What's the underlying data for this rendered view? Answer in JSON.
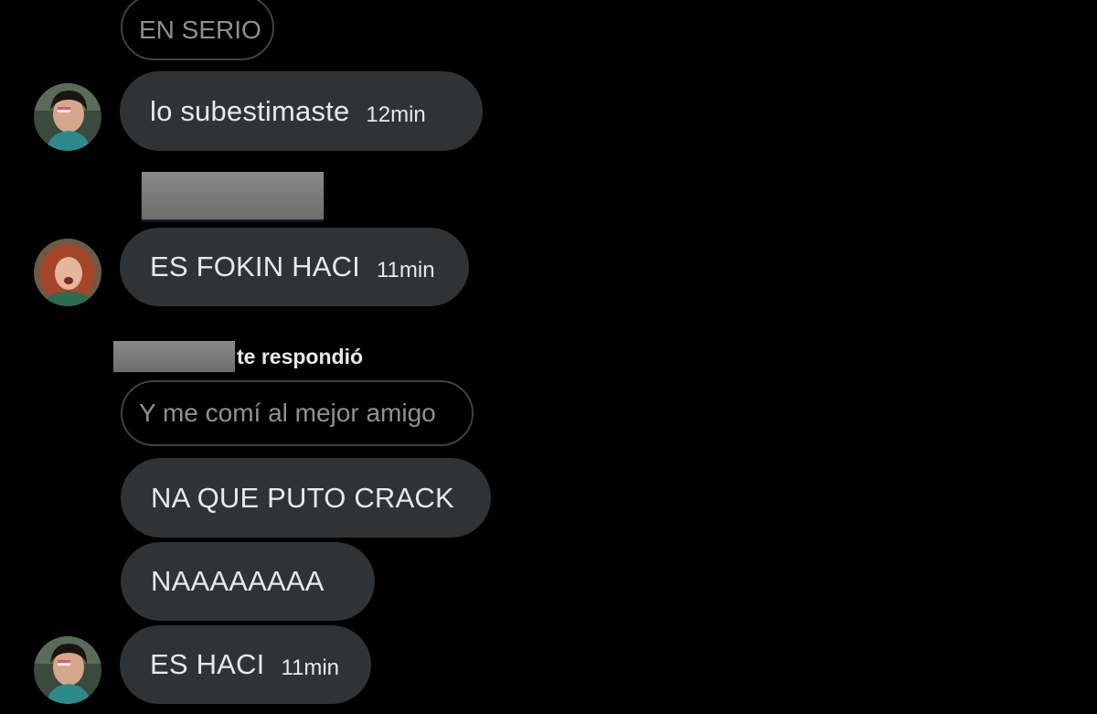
{
  "messages": {
    "quoted_top": "EN SERIO",
    "m1": {
      "text": "lo subestimaste",
      "time": "12min"
    },
    "m2": {
      "text": "ES FOKIN HACI",
      "time": "11min"
    },
    "reply": {
      "label": "te respondió",
      "quoted": "Y me comí al mejor amigo"
    },
    "m3": {
      "text": "NA QUE PUTO CRACK"
    },
    "m4": {
      "text": "NAAAAAAAA"
    },
    "m5": {
      "text": "ES HACI",
      "time": "11min"
    }
  },
  "avatars": {
    "a1": "avatar-boy-icon",
    "a2": "avatar-redhead-icon",
    "a3": "avatar-boy-icon"
  },
  "colors": {
    "background": "#000000",
    "bubble": "#2f3336",
    "text": "#e7e9ea",
    "muted": "#8b9196"
  }
}
